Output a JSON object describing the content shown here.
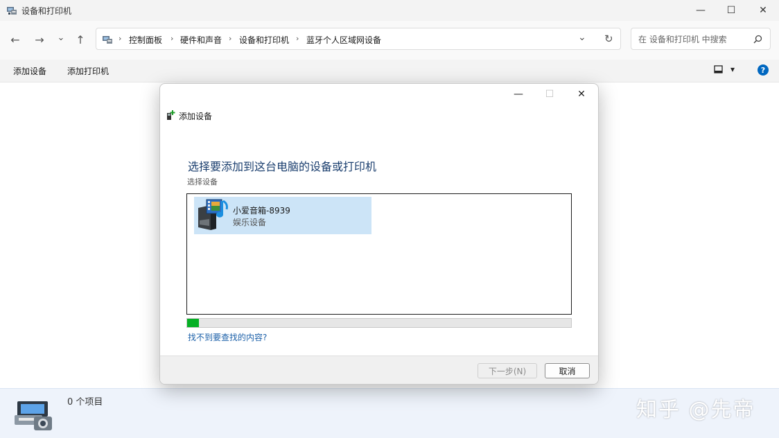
{
  "window": {
    "title": "设备和打印机",
    "minimize": "—",
    "maximize": "☐",
    "close": "✕"
  },
  "nav": {
    "back": "←",
    "forward": "→",
    "recent": "⌄",
    "up": "↑",
    "breadcrumbs": [
      "控制面板",
      "硬件和声音",
      "设备和打印机",
      "蓝牙个人区域网设备"
    ],
    "separator": "›",
    "dropdown": "⌄",
    "refresh": "↻"
  },
  "search": {
    "placeholder": "在 设备和打印机 中搜索"
  },
  "toolbar": {
    "add_device": "添加设备",
    "add_printer": "添加打印机",
    "view_caret": "▾",
    "help": "?"
  },
  "dialog": {
    "title": "添加设备",
    "heading": "选择要添加到这台电脑的设备或打印机",
    "subheading": "选择设备",
    "devices": [
      {
        "name": "小爱音箱-8939",
        "type": "娱乐设备"
      }
    ],
    "progress": 0.03,
    "help_link": "找不到要查找的内容?",
    "next_label": "下一步(N)",
    "cancel_label": "取消",
    "minimize": "—",
    "maximize": "☐",
    "close": "✕"
  },
  "status": {
    "item_count": "0 个项目"
  },
  "watermark": "知乎 @先帝",
  "colors": {
    "accent": "#0067c0",
    "progress": "#06b025",
    "selection": "#cce4f7",
    "heading": "#1a3e6e",
    "link": "#1a5fa8"
  }
}
